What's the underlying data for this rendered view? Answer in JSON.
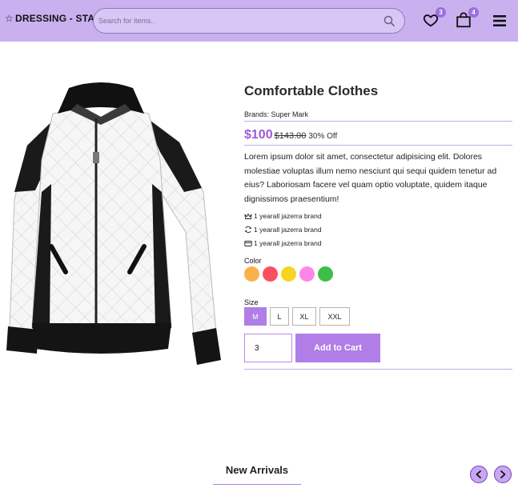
{
  "header": {
    "brand": "DRESSING - STAR",
    "search_placeholder": "Search for items..",
    "wishlist_count": "3",
    "cart_count": "4"
  },
  "product": {
    "title": "Comfortable Clothes",
    "brands": "Brands: Super Mark",
    "price": "$100",
    "old_price": "$143.00",
    "discount": "30% Off",
    "description": "Lorem ipsum dolor sit amet, consectetur adipisicing elit. Dolores molestiae voluptas illum nemo nesciunt qui sequi quidem tenetur ad eius? Laboriosam facere vel quam optio voluptate, quidem itaque dignissimos praesentium!",
    "features": [
      {
        "icon": "crown-icon",
        "text": "1 yearall jazerra brand"
      },
      {
        "icon": "refresh-icon",
        "text": "1 yearall jazerra brand"
      },
      {
        "icon": "card-icon",
        "text": "1 yearall jazerra brand"
      }
    ],
    "color_label": "Color",
    "colors": [
      "#f9b24a",
      "#f9505d",
      "#f8d324",
      "#ff86e8",
      "#3dbf45"
    ],
    "size_label": "Size",
    "sizes": [
      "M",
      "L",
      "XL",
      "XXL"
    ],
    "selected_size": "M",
    "quantity": "3",
    "add_to_cart_label": "Add to Cart"
  },
  "section": {
    "title": "New Arrivals"
  },
  "accent_color": "#b07ee6"
}
